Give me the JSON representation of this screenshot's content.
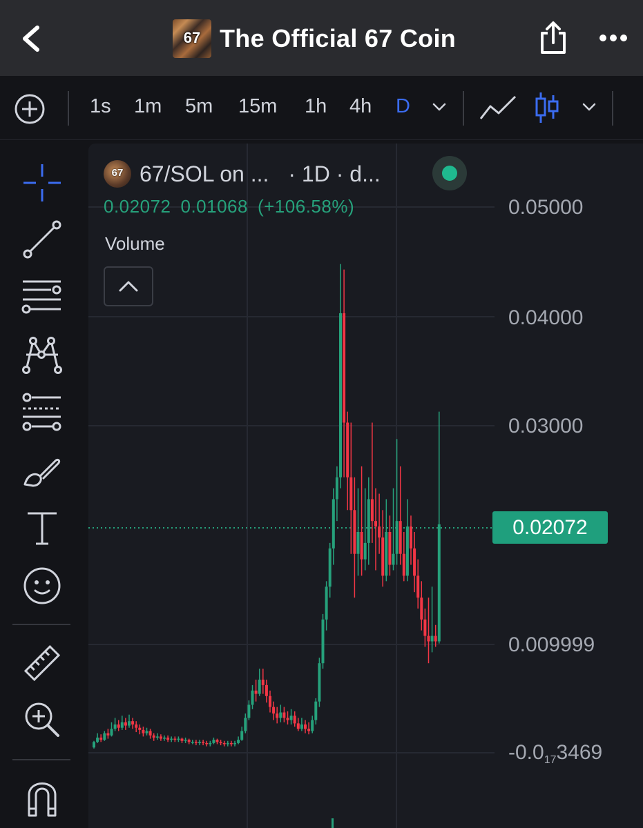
{
  "nav": {
    "title": "The Official 67 Coin",
    "logo_text": "67",
    "icons": [
      "back-arrow-icon",
      "share-icon",
      "more-dots-icon"
    ]
  },
  "toolbar": {
    "timeframes": [
      {
        "label": "1s",
        "active": false
      },
      {
        "label": "1m",
        "active": false
      },
      {
        "label": "5m",
        "active": false
      },
      {
        "label": "15m",
        "active": false
      },
      {
        "label": "1h",
        "active": false
      },
      {
        "label": "4h",
        "active": false
      },
      {
        "label": "D",
        "active": true
      }
    ],
    "accent_color": "#3b6cf0"
  },
  "tools": [
    "crosshair-icon",
    "trend-line-icon",
    "horizontal-lines-icon",
    "pattern-icon",
    "fib-icon",
    "brush-icon",
    "text-icon",
    "emoji-icon",
    "ruler-icon",
    "zoom-in-icon",
    "magnet-icon"
  ],
  "legend": {
    "logo_text": "67",
    "pair": "67/SOL on ...",
    "interval": "· 1D · d...",
    "price": "0.02072",
    "change": "0.01068",
    "change_pct": "(+106.58%)",
    "volume_label": "Volume"
  },
  "axis": {
    "labels": [
      "0.05000",
      "0.04000",
      "0.03000",
      "0.009999"
    ],
    "bottom_prefix": "-0.0",
    "bottom_sub": "17",
    "bottom_suffix": "3469",
    "last_price": "0.02072"
  },
  "colors": {
    "up": "#26a17b",
    "down": "#f23645",
    "last_price_bg": "#1f9f7d"
  },
  "chart_data": {
    "type": "candlestick",
    "title": "",
    "ylim": [
      0,
      0.052
    ],
    "yticks": [
      0.05,
      0.04,
      0.03,
      0.009999
    ],
    "last_price": 0.02072,
    "candles": [
      [
        0.0003,
        0.0008,
        0.0002,
        0.0009
      ],
      [
        0.0008,
        0.0012,
        0.0007,
        0.0016
      ],
      [
        0.0012,
        0.001,
        0.0008,
        0.0015
      ],
      [
        0.001,
        0.0016,
        0.0009,
        0.0018
      ],
      [
        0.0016,
        0.0014,
        0.0011,
        0.002
      ],
      [
        0.0014,
        0.002,
        0.0013,
        0.0026
      ],
      [
        0.002,
        0.0024,
        0.0018,
        0.003
      ],
      [
        0.0024,
        0.0021,
        0.0018,
        0.0028
      ],
      [
        0.0021,
        0.0026,
        0.0019,
        0.0032
      ],
      [
        0.0026,
        0.0023,
        0.0019,
        0.003
      ],
      [
        0.0023,
        0.0027,
        0.0021,
        0.0033
      ],
      [
        0.0027,
        0.0024,
        0.002,
        0.003
      ],
      [
        0.0024,
        0.0021,
        0.0017,
        0.0027
      ],
      [
        0.0021,
        0.0019,
        0.0015,
        0.0024
      ],
      [
        0.0019,
        0.0016,
        0.0013,
        0.0022
      ],
      [
        0.0016,
        0.0018,
        0.0014,
        0.0021
      ],
      [
        0.0018,
        0.0014,
        0.0011,
        0.002
      ],
      [
        0.0014,
        0.0012,
        0.0009,
        0.0016
      ],
      [
        0.0012,
        0.0013,
        0.001,
        0.0016
      ],
      [
        0.0013,
        0.0011,
        0.0009,
        0.0015
      ],
      [
        0.0011,
        0.0012,
        0.0009,
        0.0014
      ],
      [
        0.0012,
        0.001,
        0.0008,
        0.0014
      ],
      [
        0.001,
        0.0011,
        0.0008,
        0.0013
      ],
      [
        0.0011,
        0.001,
        0.0008,
        0.0013
      ],
      [
        0.001,
        0.0011,
        0.0008,
        0.0013
      ],
      [
        0.0011,
        0.0009,
        0.0007,
        0.0012
      ],
      [
        0.0009,
        0.001,
        0.0007,
        0.0012
      ],
      [
        0.001,
        0.0008,
        0.0006,
        0.0011
      ],
      [
        0.0008,
        0.0008,
        0.0006,
        0.001
      ],
      [
        0.0008,
        0.0007,
        0.0005,
        0.001
      ],
      [
        0.0007,
        0.0008,
        0.0005,
        0.001
      ],
      [
        0.0008,
        0.0007,
        0.0005,
        0.001
      ],
      [
        0.0007,
        0.0006,
        0.0004,
        0.0009
      ],
      [
        0.0006,
        0.0007,
        0.0004,
        0.0009
      ],
      [
        0.0007,
        0.001,
        0.0006,
        0.0012
      ],
      [
        0.001,
        0.0008,
        0.0006,
        0.0011
      ],
      [
        0.0008,
        0.0007,
        0.0005,
        0.001
      ],
      [
        0.0007,
        0.0006,
        0.0004,
        0.0009
      ],
      [
        0.0006,
        0.0007,
        0.0004,
        0.0009
      ],
      [
        0.0007,
        0.0006,
        0.0004,
        0.0009
      ],
      [
        0.0006,
        0.0007,
        0.0004,
        0.0009
      ],
      [
        0.0007,
        0.001,
        0.0006,
        0.0013
      ],
      [
        0.001,
        0.0018,
        0.0009,
        0.0022
      ],
      [
        0.0018,
        0.003,
        0.0016,
        0.0034
      ],
      [
        0.003,
        0.0042,
        0.0028,
        0.0046
      ],
      [
        0.0042,
        0.0055,
        0.0038,
        0.006
      ],
      [
        0.0055,
        0.0052,
        0.0045,
        0.0065
      ],
      [
        0.0052,
        0.0065,
        0.005,
        0.0075
      ],
      [
        0.0065,
        0.006,
        0.0052,
        0.0075
      ],
      [
        0.006,
        0.005,
        0.0044,
        0.0065
      ],
      [
        0.005,
        0.004,
        0.0035,
        0.0055
      ],
      [
        0.004,
        0.0034,
        0.0028,
        0.0045
      ],
      [
        0.0034,
        0.003,
        0.0025,
        0.004
      ],
      [
        0.003,
        0.0035,
        0.0026,
        0.0042
      ],
      [
        0.0035,
        0.003,
        0.0026,
        0.004
      ],
      [
        0.003,
        0.0028,
        0.0024,
        0.0036
      ],
      [
        0.0028,
        0.0032,
        0.0024,
        0.0038
      ],
      [
        0.0032,
        0.0025,
        0.0022,
        0.0036
      ],
      [
        0.0025,
        0.002,
        0.0018,
        0.003
      ],
      [
        0.002,
        0.0024,
        0.0018,
        0.003
      ],
      [
        0.0024,
        0.002,
        0.0016,
        0.0028
      ],
      [
        0.002,
        0.0018,
        0.0015,
        0.0026
      ],
      [
        0.0018,
        0.0028,
        0.0016,
        0.0032
      ],
      [
        0.0028,
        0.0045,
        0.0024,
        0.0048
      ],
      [
        0.0045,
        0.008,
        0.004,
        0.0085
      ],
      [
        0.008,
        0.012,
        0.0075,
        0.0125
      ],
      [
        0.012,
        0.015,
        0.011,
        0.0155
      ],
      [
        0.015,
        0.0185,
        0.014,
        0.019
      ],
      [
        0.0185,
        0.023,
        0.017,
        0.024
      ],
      [
        0.023,
        0.025,
        0.021,
        0.026
      ],
      [
        0.025,
        0.04,
        0.024,
        0.0445
      ],
      [
        0.04,
        0.03,
        0.025,
        0.044
      ],
      [
        0.03,
        0.025,
        0.022,
        0.031
      ],
      [
        0.025,
        0.022,
        0.018,
        0.03
      ],
      [
        0.022,
        0.018,
        0.014,
        0.025
      ],
      [
        0.018,
        0.02,
        0.016,
        0.024
      ],
      [
        0.02,
        0.0175,
        0.016,
        0.026
      ],
      [
        0.0175,
        0.019,
        0.0165,
        0.024
      ],
      [
        0.019,
        0.023,
        0.017,
        0.025
      ],
      [
        0.023,
        0.021,
        0.019,
        0.03
      ],
      [
        0.021,
        0.0205,
        0.0165,
        0.024
      ],
      [
        0.0205,
        0.0195,
        0.018,
        0.0235
      ],
      [
        0.0195,
        0.016,
        0.015,
        0.022
      ],
      [
        0.016,
        0.02,
        0.0155,
        0.023
      ],
      [
        0.02,
        0.017,
        0.016,
        0.0215
      ],
      [
        0.017,
        0.018,
        0.0165,
        0.024
      ],
      [
        0.018,
        0.021,
        0.017,
        0.0285
      ],
      [
        0.021,
        0.018,
        0.017,
        0.026
      ],
      [
        0.018,
        0.016,
        0.0155,
        0.02
      ],
      [
        0.016,
        0.0205,
        0.0155,
        0.023
      ],
      [
        0.0205,
        0.0185,
        0.017,
        0.0215
      ],
      [
        0.0185,
        0.016,
        0.0145,
        0.02
      ],
      [
        0.016,
        0.014,
        0.013,
        0.0175
      ],
      [
        0.014,
        0.012,
        0.011,
        0.0155
      ],
      [
        0.012,
        0.0105,
        0.0095,
        0.013
      ],
      [
        0.0105,
        0.01,
        0.008,
        0.014
      ],
      [
        0.01,
        0.0105,
        0.009,
        0.015
      ],
      [
        0.0105,
        0.01,
        0.0095,
        0.0115
      ],
      [
        0.01,
        0.0207,
        0.0098,
        0.031
      ]
    ]
  }
}
